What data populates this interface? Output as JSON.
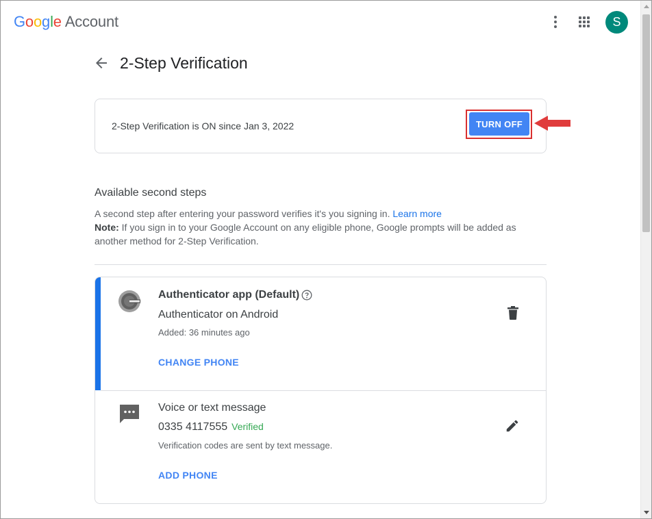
{
  "header": {
    "logo_google": [
      "G",
      "o",
      "o",
      "g",
      "l",
      "e"
    ],
    "logo_account": "Account",
    "avatar_initial": "S",
    "more_icon": "vertical-dots-icon",
    "apps_icon": "apps-grid-icon",
    "avatar_color": "#00897b"
  },
  "page": {
    "title": "2-Step Verification",
    "back_icon": "arrow-back-icon"
  },
  "status": {
    "text": "2-Step Verification is ON since Jan 3, 2022",
    "turn_off_label": "TURN OFF",
    "button_color": "#4285f4",
    "highlight_color": "#d93030"
  },
  "second_steps": {
    "title": "Available second steps",
    "description": "A second step after entering your password verifies it's you signing in.",
    "learn_more": "Learn more",
    "note_label": "Note:",
    "note_text": " If you sign in to your Google Account on any eligible phone, Google prompts will be added as another method for 2-Step Verification."
  },
  "methods": [
    {
      "title": "Authenticator app (Default)",
      "device": "Authenticator on Android",
      "detail": "Added: 36 minutes ago",
      "action": "CHANGE PHONE",
      "icon": "authenticator-icon",
      "secondary_icon": "help-icon",
      "end_icon": "trash-icon"
    },
    {
      "title": "Voice or text message",
      "device": "0335 4117555",
      "status": "Verified",
      "detail": "Verification codes are sent by text message.",
      "action": "ADD PHONE",
      "icon": "sms-icon",
      "end_icon": "edit-icon"
    }
  ]
}
